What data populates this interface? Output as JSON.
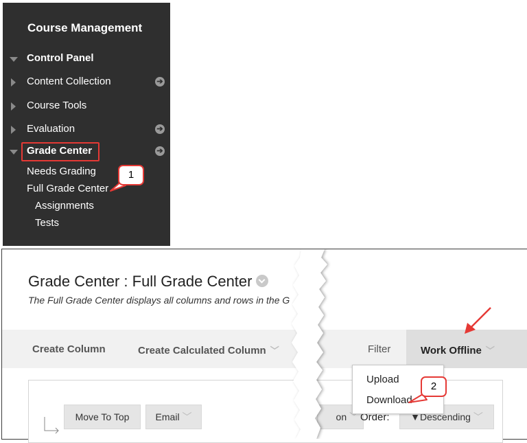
{
  "sidebar": {
    "title": "Course Management",
    "items": [
      {
        "label": "Control Panel"
      },
      {
        "label": "Content Collection"
      },
      {
        "label": "Course Tools"
      },
      {
        "label": "Evaluation"
      },
      {
        "label": "Grade Center"
      }
    ],
    "grade_center_children": [
      {
        "label": "Needs Grading"
      },
      {
        "label": "Full Grade Center"
      },
      {
        "label": "Assignments"
      },
      {
        "label": "Tests"
      }
    ]
  },
  "callouts": {
    "one": "1",
    "two": "2"
  },
  "page": {
    "title": "Grade Center : Full Grade Center",
    "description": "The Full Grade Center displays all columns and rows in the G"
  },
  "action_bar": {
    "create_column": "Create Column",
    "create_calculated_column": "Create Calculated Column",
    "filter": "Filter",
    "work_offline": "Work Offline"
  },
  "work_offline_menu": {
    "upload": "Upload",
    "download": "Download"
  },
  "toolbar": {
    "move_to_top": "Move To Top",
    "email": "Email",
    "partial_button": "on",
    "order_label": "Order:",
    "order_value": "Descending"
  },
  "colors": {
    "sidebar_bg": "#2f2f2f",
    "annotation_red": "#e53935",
    "action_bar_bg": "#f1f1f1"
  }
}
